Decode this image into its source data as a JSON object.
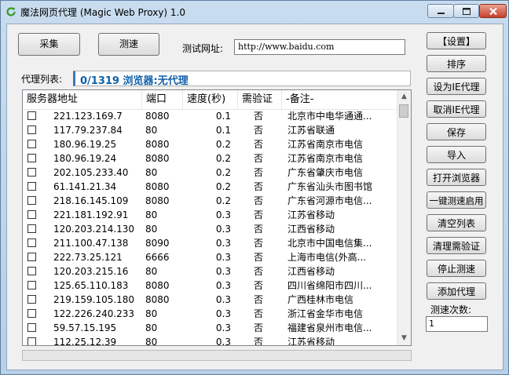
{
  "window": {
    "title": "魔法网页代理 (Magic Web Proxy) 1.0"
  },
  "toolbar": {
    "collect_label": "采集",
    "test_speed_label": "测速",
    "test_url_label": "测试网址:",
    "test_url_value": "http://www.baidu.com"
  },
  "proxy_list_label": "代理列表:",
  "status_text": "0/1319 浏览器:无代理",
  "table": {
    "headers": [
      "服务器地址",
      "端口",
      "速度(秒)",
      "需验证",
      "-备注-"
    ],
    "rows": [
      {
        "ip": "221.123.169.7",
        "port": "8080",
        "speed": "0.1",
        "verify": "否",
        "note": "北京市中电华通通..."
      },
      {
        "ip": "117.79.237.84",
        "port": "80",
        "speed": "0.1",
        "verify": "否",
        "note": "江苏省联通"
      },
      {
        "ip": "180.96.19.25",
        "port": "8080",
        "speed": "0.2",
        "verify": "否",
        "note": "江苏省南京市电信"
      },
      {
        "ip": "180.96.19.24",
        "port": "8080",
        "speed": "0.2",
        "verify": "否",
        "note": "江苏省南京市电信"
      },
      {
        "ip": "202.105.233.40",
        "port": "80",
        "speed": "0.2",
        "verify": "否",
        "note": "广东省肇庆市电信"
      },
      {
        "ip": "61.141.21.34",
        "port": "8080",
        "speed": "0.2",
        "verify": "否",
        "note": "广东省汕头市图书馆"
      },
      {
        "ip": "218.16.145.109",
        "port": "8080",
        "speed": "0.2",
        "verify": "否",
        "note": "广东省河源市电信..."
      },
      {
        "ip": "221.181.192.91",
        "port": "80",
        "speed": "0.3",
        "verify": "否",
        "note": "江苏省移动"
      },
      {
        "ip": "120.203.214.130",
        "port": "80",
        "speed": "0.3",
        "verify": "否",
        "note": "江西省移动"
      },
      {
        "ip": "211.100.47.138",
        "port": "8090",
        "speed": "0.3",
        "verify": "否",
        "note": "北京市中国电信集..."
      },
      {
        "ip": "222.73.25.121",
        "port": "6666",
        "speed": "0.3",
        "verify": "否",
        "note": "上海市电信(外高..."
      },
      {
        "ip": "120.203.215.16",
        "port": "80",
        "speed": "0.3",
        "verify": "否",
        "note": "江西省移动"
      },
      {
        "ip": "125.65.110.183",
        "port": "8080",
        "speed": "0.3",
        "verify": "否",
        "note": "四川省绵阳市四川..."
      },
      {
        "ip": "219.159.105.180",
        "port": "8080",
        "speed": "0.3",
        "verify": "否",
        "note": "广西桂林市电信"
      },
      {
        "ip": "122.226.240.233",
        "port": "80",
        "speed": "0.3",
        "verify": "否",
        "note": "浙江省金华市电信"
      },
      {
        "ip": "59.57.15.195",
        "port": "80",
        "speed": "0.3",
        "verify": "否",
        "note": "福建省泉州市电信..."
      },
      {
        "ip": "112.25.12.39",
        "port": "80",
        "speed": "0.3",
        "verify": "否",
        "note": "江苏省移动"
      }
    ]
  },
  "sidebar": {
    "buttons": [
      "【设置】",
      "排序",
      "设为IE代理",
      "取消IE代理",
      "保存",
      "导入",
      "打开浏览器",
      "一键测速启用",
      "清空列表",
      "清理需验证",
      "停止测速",
      "添加代理"
    ],
    "speed_count_label": "测速次数:",
    "speed_count_value": "1"
  },
  "progress": {
    "fraction": 0.0
  },
  "colors": {
    "status_text": "#1060a8",
    "titlebar": "#c9dcef",
    "close_button": "#c7412c"
  },
  "icons": {
    "app": "refresh-arrow-icon",
    "minimize": "minimize-icon",
    "maximize": "maximize-icon",
    "close": "close-icon",
    "scroll_up": "scroll-up-arrow-icon",
    "scroll_down": "scroll-down-arrow-icon"
  }
}
